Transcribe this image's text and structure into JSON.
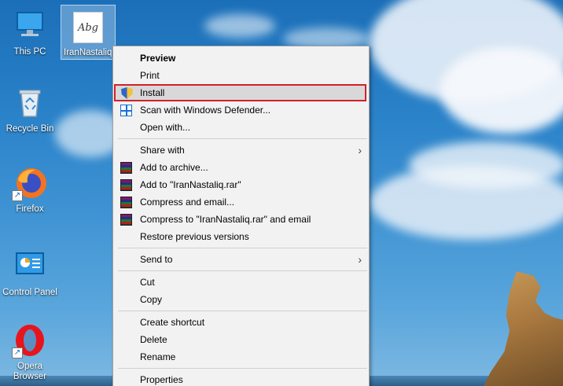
{
  "desktop": {
    "icons": [
      {
        "label": "This PC",
        "icon": "computer-icon"
      },
      {
        "label": "Recycle Bin",
        "icon": "recycle-bin-icon"
      },
      {
        "label": "Firefox",
        "icon": "firefox-icon"
      },
      {
        "label": "Control Panel",
        "icon": "control-panel-icon"
      },
      {
        "label": "Opera Browser",
        "icon": "opera-icon"
      }
    ],
    "selected_file": {
      "label": "IranNastaliq",
      "preview_text": "Abg",
      "icon": "font-file-icon"
    }
  },
  "context_menu": {
    "items": {
      "preview": "Preview",
      "print": "Print",
      "install": "Install",
      "scan": "Scan with Windows Defender...",
      "open_with": "Open with...",
      "share_with": "Share with",
      "add_archive": "Add to archive...",
      "add_rar": "Add to \"IranNastaliq.rar\"",
      "compress_email": "Compress and email...",
      "compress_rar_email": "Compress to \"IranNastaliq.rar\" and email",
      "restore": "Restore previous versions",
      "send_to": "Send to",
      "cut": "Cut",
      "copy": "Copy",
      "create_shortcut": "Create shortcut",
      "delete": "Delete",
      "rename": "Rename",
      "properties": "Properties"
    },
    "submenu_arrow": "›",
    "highlight_color": "#d1212a"
  }
}
